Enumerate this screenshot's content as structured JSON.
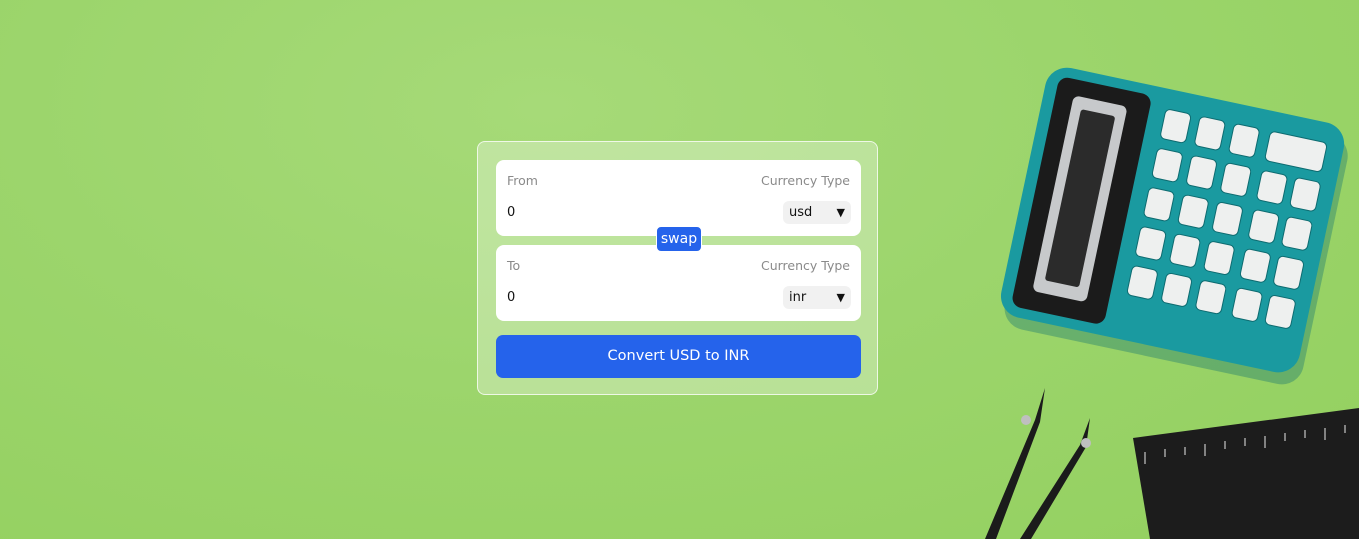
{
  "converter": {
    "from_label": "From",
    "to_label": "To",
    "currency_type_label": "Currency Type",
    "from_amount": "0",
    "to_amount": "0",
    "from_currency": "usd",
    "to_currency": "inr",
    "swap_label": "swap",
    "convert_label": "Convert USD to INR"
  },
  "colors": {
    "accent": "#2563eb",
    "background": "#9cd56c",
    "calculator": "#1a9aa0"
  }
}
